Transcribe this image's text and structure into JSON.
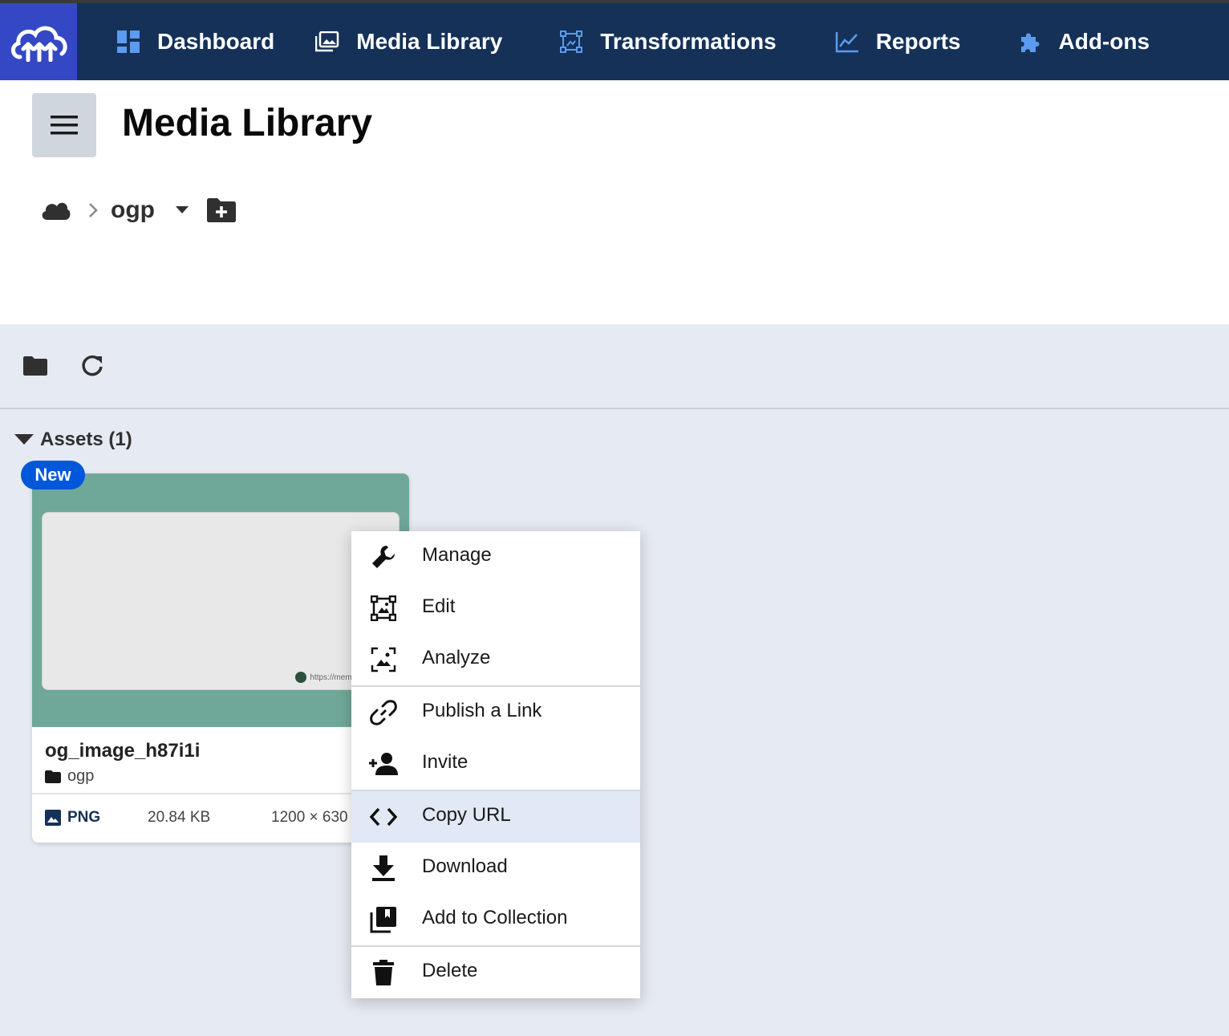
{
  "nav": {
    "items": [
      {
        "label": "Dashboard",
        "icon": "dashboard-icon"
      },
      {
        "label": "Media Library",
        "icon": "media-library-icon",
        "active": true
      },
      {
        "label": "Transformations",
        "icon": "transformations-icon"
      },
      {
        "label": "Reports",
        "icon": "reports-icon"
      },
      {
        "label": "Add-ons",
        "icon": "puzzle-icon"
      }
    ],
    "colors": {
      "bar": "#153158",
      "logo": "#3448c5",
      "icon_accent": "#5b9bf0"
    }
  },
  "header": {
    "title": "Media Library",
    "breadcrumb": {
      "folder": "ogp"
    }
  },
  "assets": {
    "heading": "Assets (1)",
    "card": {
      "badge": "New",
      "thumb_url": "https://memo.",
      "name": "og_image_h87i1i",
      "folder": "ogp",
      "format": "PNG",
      "size": "20.84 KB",
      "dimensions": "1200 × 630"
    }
  },
  "context_menu": {
    "items": [
      {
        "label": "Manage",
        "icon": "wrench-icon"
      },
      {
        "label": "Edit",
        "icon": "edit-frame-icon"
      },
      {
        "label": "Analyze",
        "icon": "analyze-icon"
      },
      {
        "label": "Publish a Link",
        "icon": "link-icon"
      },
      {
        "label": "Invite",
        "icon": "add-person-icon"
      },
      {
        "label": "Copy URL",
        "icon": "code-icon",
        "highlighted": true
      },
      {
        "label": "Download",
        "icon": "download-icon"
      },
      {
        "label": "Add to Collection",
        "icon": "collection-icon"
      },
      {
        "label": "Delete",
        "icon": "trash-icon"
      }
    ],
    "highlight_color": "#e1e9f7"
  }
}
